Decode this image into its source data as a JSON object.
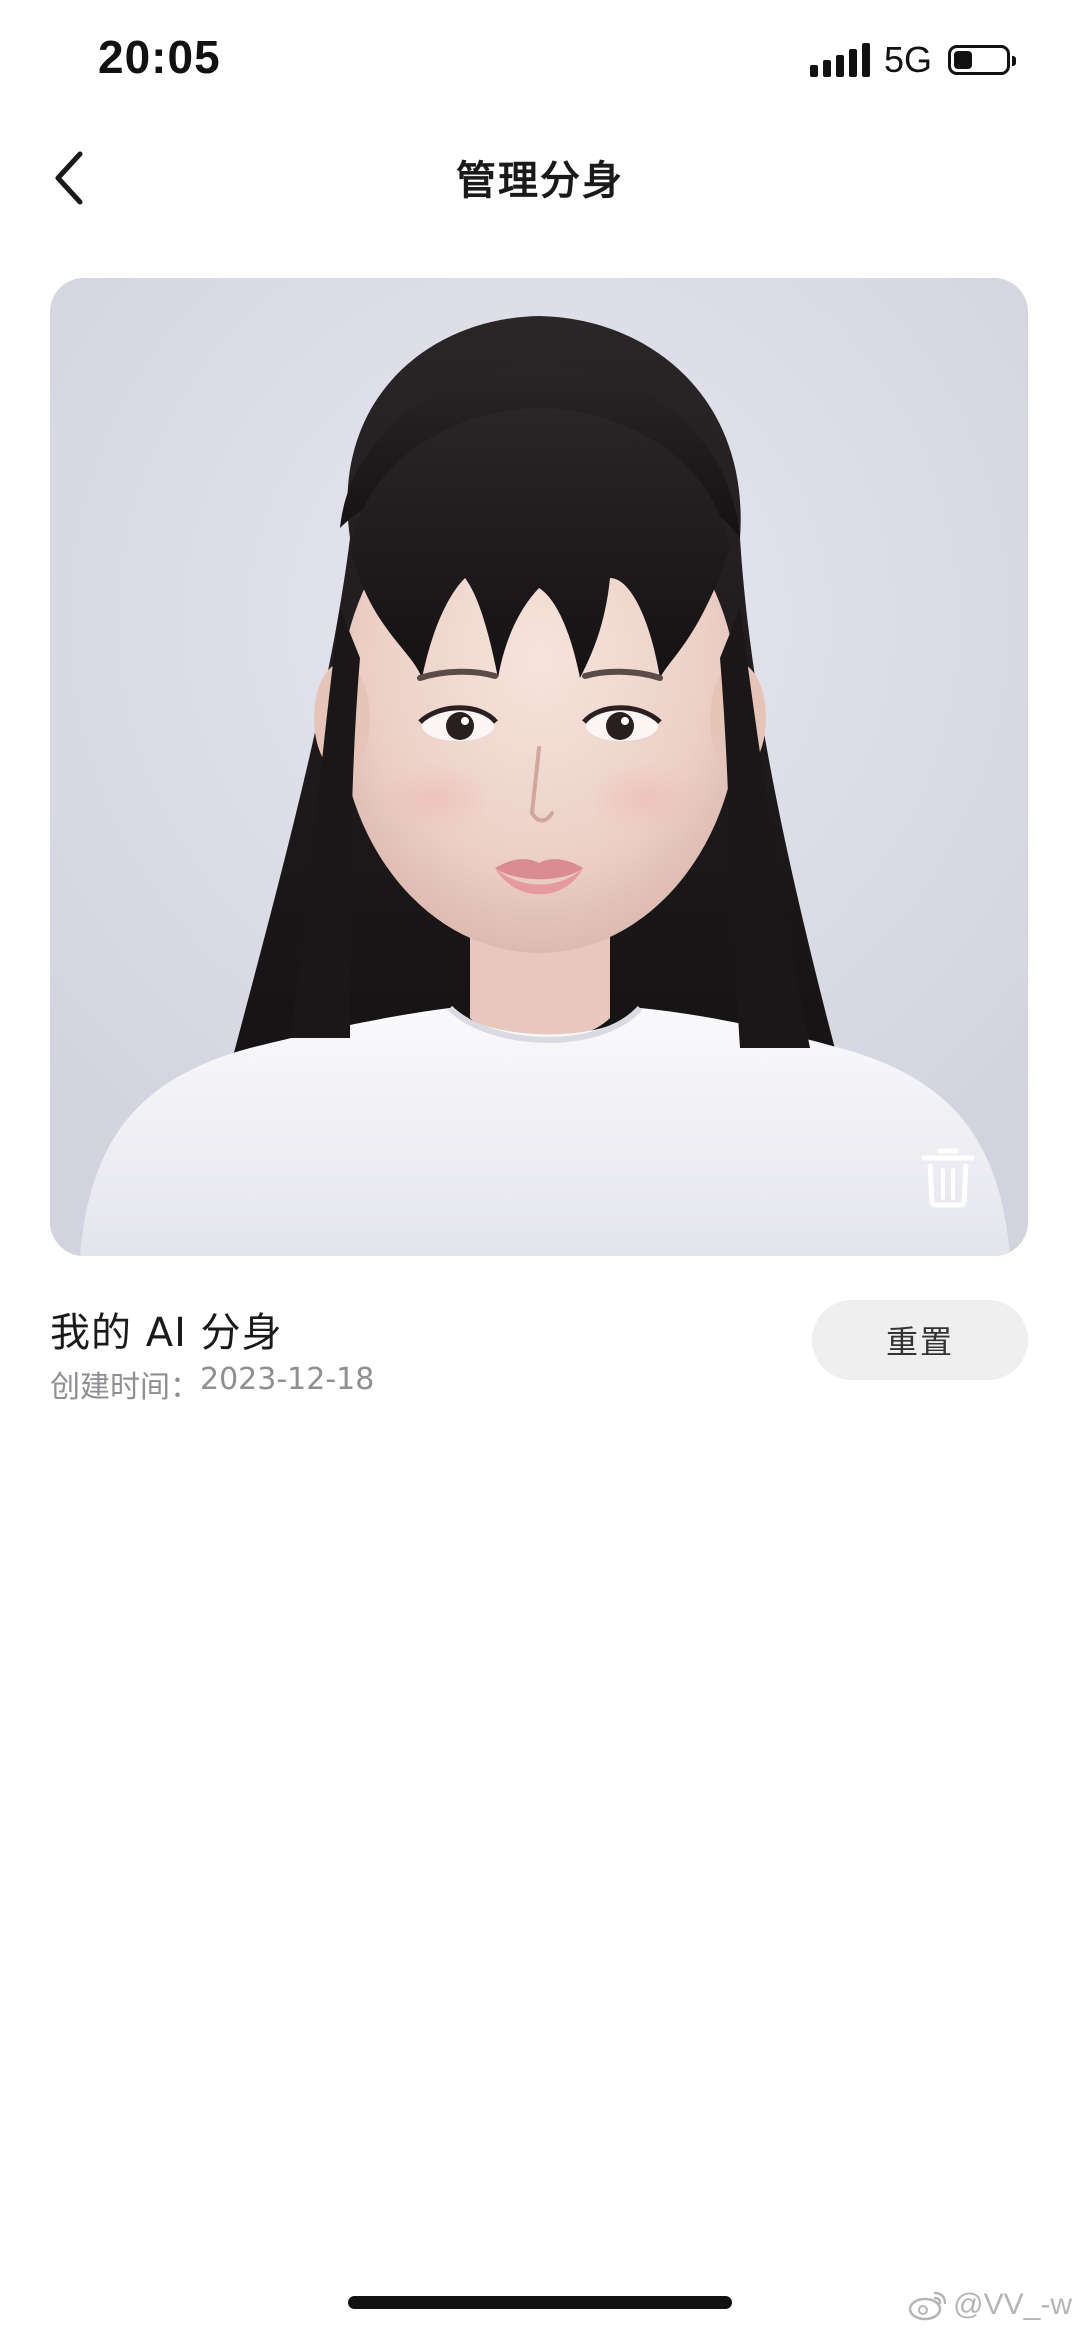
{
  "status_bar": {
    "time": "20:05",
    "network": "5G",
    "signal_icon": "signal-bars-icon",
    "battery_icon": "battery-icon"
  },
  "nav": {
    "title": "管理分身",
    "back_icon": "chevron-left-icon"
  },
  "avatar_card": {
    "photo": "ai-avatar-portrait",
    "delete_icon": "trash-icon"
  },
  "avatar_info": {
    "title": "我的 AI 分身",
    "created_label": "创建时间：",
    "created_date": "2023-12-18",
    "reset_label": "重置"
  },
  "watermark": {
    "text": "@VV_-w",
    "icon": "weibo-icon"
  },
  "colors": {
    "background": "#ffffff",
    "photo_bg": "#dcdde7",
    "reset_bg": "#efefef",
    "subtext": "#8e8e93"
  }
}
